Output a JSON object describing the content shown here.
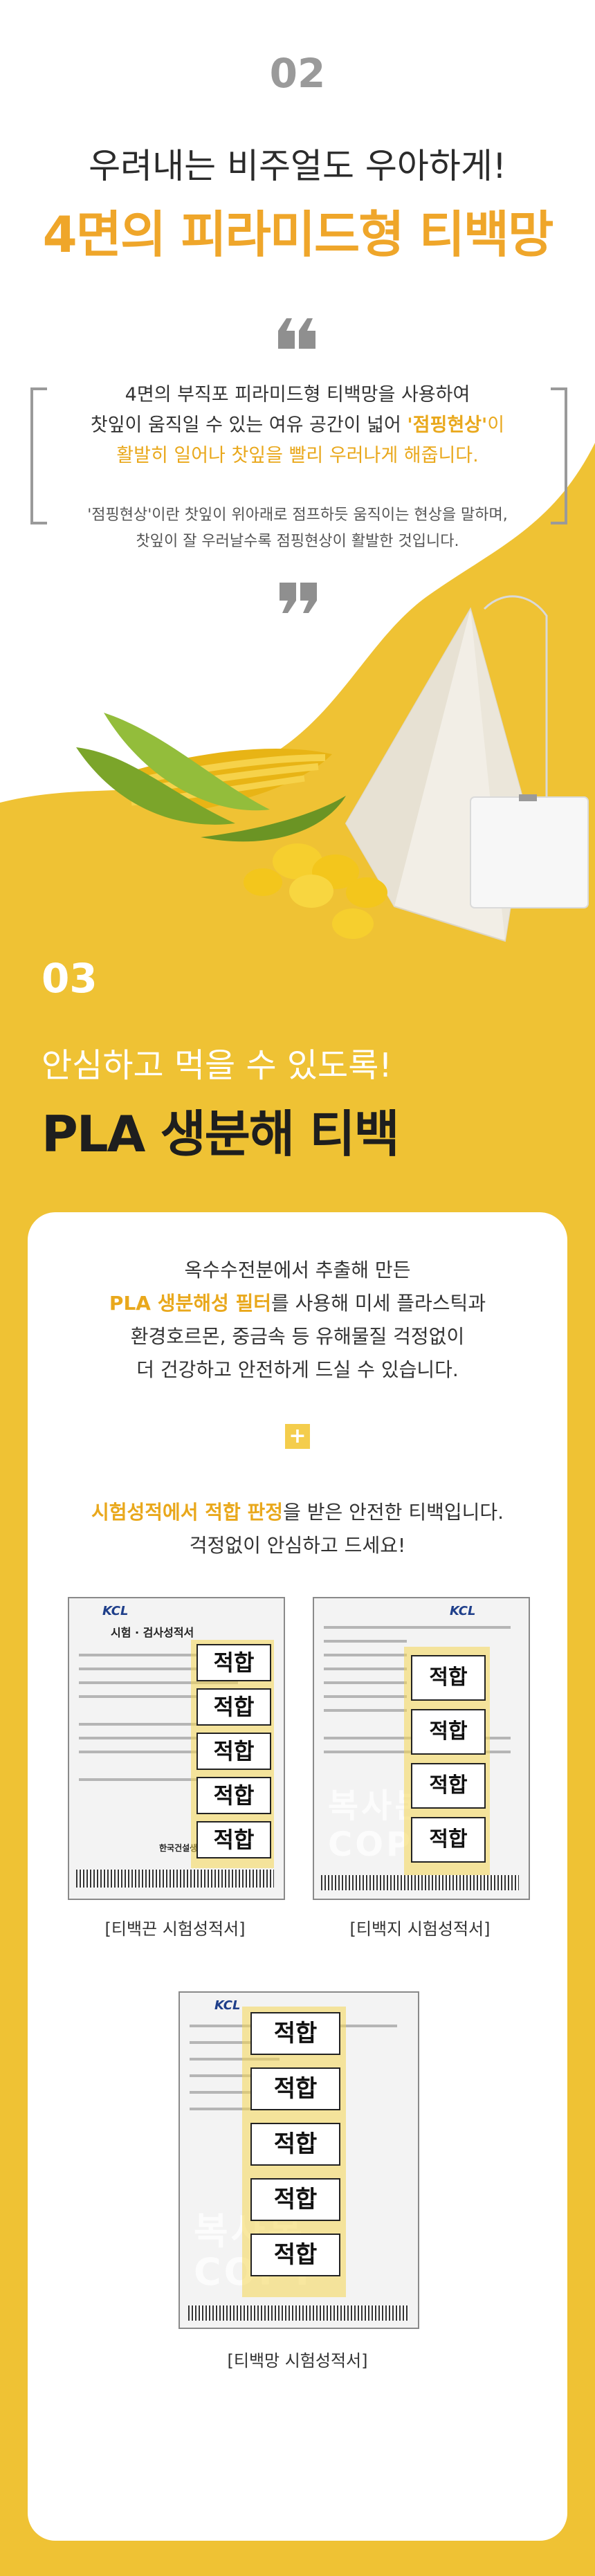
{
  "section2": {
    "number": "02",
    "subtitle": "우려내는 비주얼도 우아하게!",
    "title": "4면의 피라미드형 티백망",
    "quote": {
      "line1": "4면의 부직포 피라미드형 티백망을 사용하여",
      "line2a": "찻잎이 움직일 수 있는 여유 공간이 넓어 ",
      "line2b": "'점핑현상'",
      "line2c": "이",
      "line3": "활발히 일어나 찻잎을 빨리 우러나게 해줍니다.",
      "note1": "'점핑현상'이란 찻잎이 위아래로 점프하듯 움직이는 현상을 말하며,",
      "note2": "찻잎이 잘 우러날수록 점핑현상이 활발한 것입니다."
    }
  },
  "section3": {
    "number": "03",
    "subtitle": "안심하고 먹을 수 있도록!",
    "title": "PLA 생분해 티백",
    "desc": {
      "line1": "옥수수전분에서 추출해 만든",
      "line2a": "PLA 생분해성 필터",
      "line2b": "를 사용해 미세 플라스틱과",
      "line3": "환경호르몬, 중금속 등 유해물질 걱정없이",
      "line4": "더 건강하고 안전하게 드실 수 있습니다."
    },
    "plus": "+",
    "cert": {
      "line1a": "시험성적에서 적합 판정",
      "line1b": "을 받은 안전한 티백입니다.",
      "line2": "걱정없이 안심하고 드세요!"
    },
    "docs": [
      {
        "caption": "[티백끈 시험성적서]",
        "doc_title": "시험 · 검사성적서",
        "logo": "KCL",
        "footer": "한국건설생활환경시험연구원"
      },
      {
        "caption": "[티백지 시험성적서]",
        "logo": "KCL",
        "watermark1": "복사본",
        "watermark2": "COPY"
      },
      {
        "caption": "[티백망 시험성적서]",
        "logo": "KCL",
        "watermark1": "복사본",
        "watermark2": "COPY"
      }
    ],
    "stamp_text": "적합"
  },
  "colors": {
    "accent": "#efc234",
    "highlight": "#e9a81c",
    "dark": "#2b2b2b",
    "gray": "#8f8f8f"
  }
}
